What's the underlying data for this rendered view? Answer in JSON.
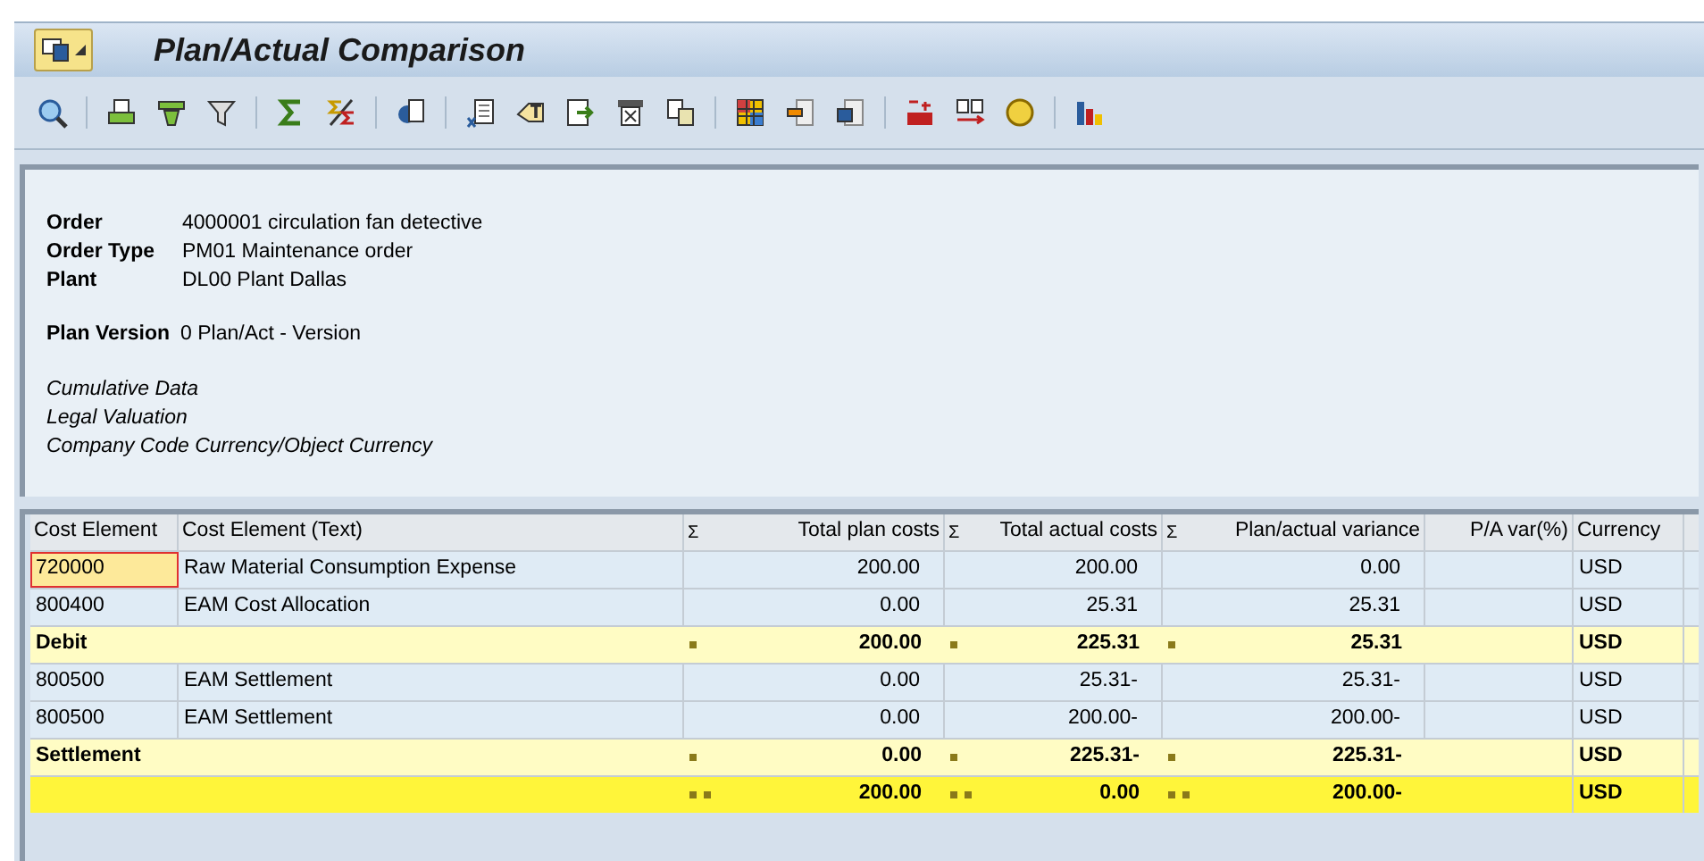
{
  "window": {
    "title": "Plan/Actual Comparison"
  },
  "header": {
    "fields": [
      {
        "label": "Order",
        "value": "4000001 circulation fan detective"
      },
      {
        "label": "Order Type",
        "value": "PM01 Maintenance order"
      },
      {
        "label": "Plant",
        "value": "DL00 Plant Dallas"
      }
    ],
    "plan_version": {
      "label": "Plan Version",
      "value": "0 Plan/Act - Version"
    },
    "notes": [
      "Cumulative Data",
      "Legal Valuation",
      "Company Code Currency/Object Currency"
    ]
  },
  "table": {
    "columns": [
      {
        "label": "Cost Element",
        "kind": "text"
      },
      {
        "label": "Cost Element (Text)",
        "kind": "text"
      },
      {
        "label": "Total plan costs",
        "sum_mark": "Σ",
        "kind": "amount"
      },
      {
        "label": "Total actual costs",
        "sum_mark": "Σ",
        "kind": "amount"
      },
      {
        "label": "Plan/actual variance",
        "sum_mark": "Σ",
        "kind": "amount"
      },
      {
        "label": "P/A var(%)",
        "kind": "amount"
      },
      {
        "label": "Currency",
        "kind": "text"
      }
    ],
    "rows": [
      {
        "kind": "item",
        "selected": true,
        "cells": [
          "720000",
          "Raw Material Consumption Expense",
          "200.00",
          "200.00",
          "0.00",
          null,
          "USD"
        ]
      },
      {
        "kind": "item",
        "selected": false,
        "cells": [
          "800400",
          "EAM Cost Allocation",
          "0.00",
          "25.31",
          "25.31",
          null,
          "USD"
        ]
      },
      {
        "kind": "subtotal",
        "selected": false,
        "cells": [
          "Debit",
          null,
          "200.00",
          "225.31",
          "25.31",
          null,
          "USD"
        ]
      },
      {
        "kind": "item",
        "selected": false,
        "cells": [
          "800500",
          "EAM Settlement",
          "0.00",
          "25.31-",
          "25.31-",
          null,
          "USD"
        ]
      },
      {
        "kind": "item",
        "selected": false,
        "cells": [
          "800500",
          "EAM Settlement",
          "0.00",
          "200.00-",
          "200.00-",
          null,
          "USD"
        ]
      },
      {
        "kind": "subtotal",
        "selected": false,
        "cells": [
          "Settlement",
          null,
          "0.00",
          "225.31-",
          "225.31-",
          null,
          "USD"
        ]
      },
      {
        "kind": "total",
        "selected": false,
        "cells": [
          null,
          null,
          "200.00",
          "0.00",
          "200.00-",
          null,
          "USD"
        ]
      }
    ]
  }
}
